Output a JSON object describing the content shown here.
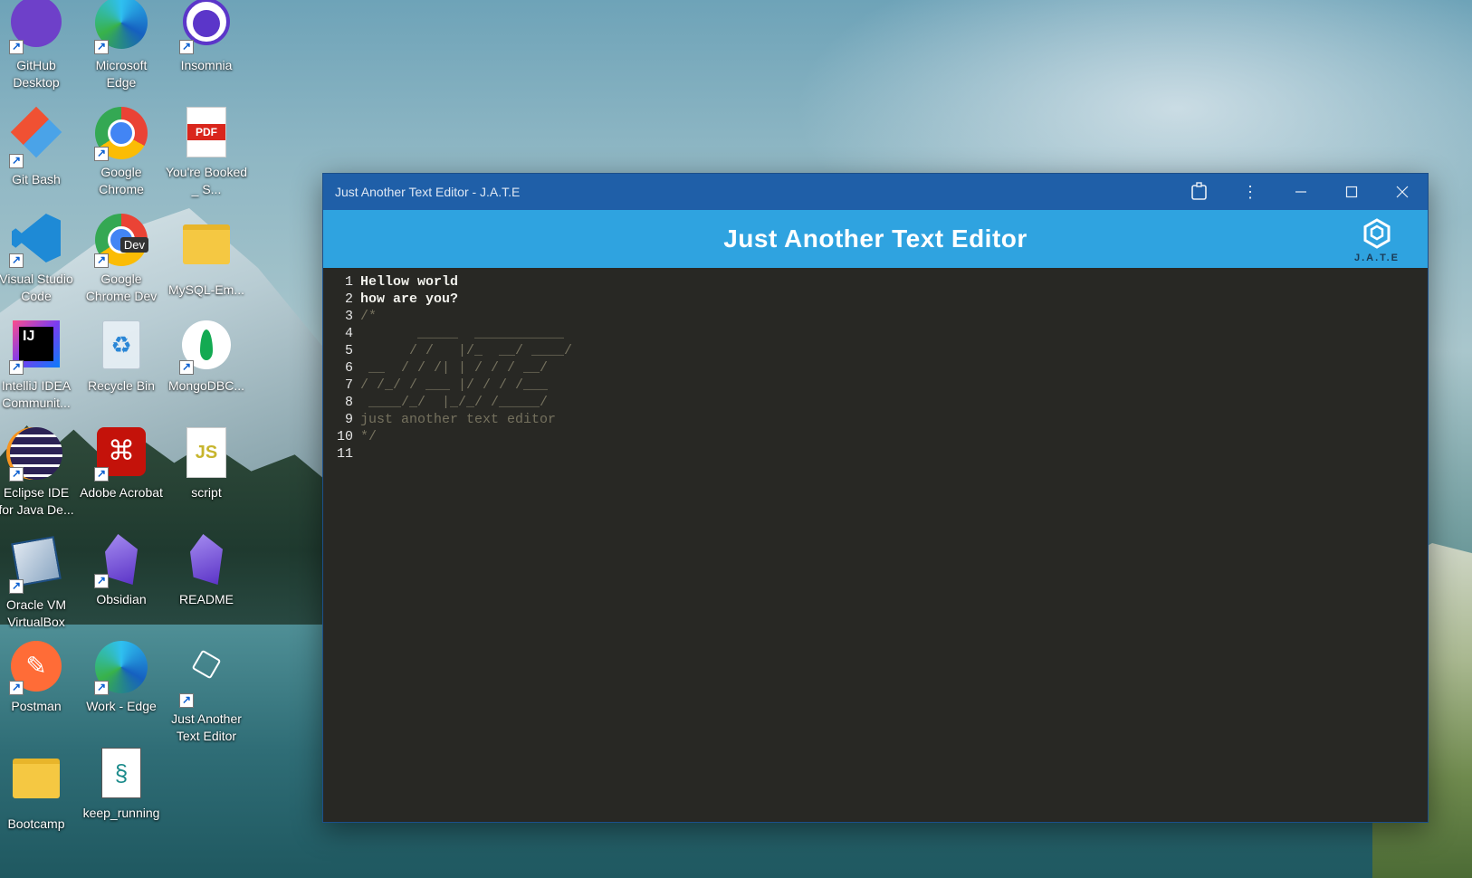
{
  "desktop": {
    "icons": [
      {
        "label": "GitHub Desktop",
        "icon": "github-desktop-icon"
      },
      {
        "label": "Microsoft Edge",
        "icon": "edge-icon"
      },
      {
        "label": "Insomnia",
        "icon": "insomnia-icon"
      },
      {
        "label": "Git Bash",
        "icon": "git-bash-icon"
      },
      {
        "label": "Google Chrome",
        "icon": "chrome-icon"
      },
      {
        "label": "You're Booked _ S...",
        "icon": "pdf-file-icon"
      },
      {
        "label": "Visual Studio Code",
        "icon": "vscode-icon"
      },
      {
        "label": "Google Chrome Dev",
        "icon": "chrome-dev-icon"
      },
      {
        "label": "MySQL-Em...",
        "icon": "folder-icon"
      },
      {
        "label": "IntelliJ IDEA Communit...",
        "icon": "intellij-icon"
      },
      {
        "label": "Recycle Bin",
        "icon": "recycle-bin-icon"
      },
      {
        "label": "MongoDBC...",
        "icon": "mongodb-compass-icon"
      },
      {
        "label": "Eclipse IDE for Java De...",
        "icon": "eclipse-icon"
      },
      {
        "label": "Adobe Acrobat",
        "icon": "acrobat-icon"
      },
      {
        "label": "script",
        "icon": "js-file-icon"
      },
      {
        "label": "Oracle VM VirtualBox",
        "icon": "virtualbox-icon"
      },
      {
        "label": "Obsidian",
        "icon": "obsidian-icon"
      },
      {
        "label": "README",
        "icon": "obsidian-file-icon"
      },
      {
        "label": "Postman",
        "icon": "postman-icon"
      },
      {
        "label": "Work - Edge",
        "icon": "edge-work-icon"
      },
      {
        "label": "Just Another Text Editor",
        "icon": "jate-icon"
      },
      {
        "label": "Bootcamp",
        "icon": "folder-icon"
      },
      {
        "label": "keep_running",
        "icon": "script-file-icon"
      }
    ],
    "badges": {
      "chrome_dev": "Dev",
      "pdf": "PDF",
      "intellij": "IJ",
      "js": "JS"
    }
  },
  "window": {
    "title": "Just Another Text Editor - J.A.T.E",
    "controls": {
      "extension": "extension-icon",
      "menu": "more-icon",
      "minimize": "minimize-icon",
      "maximize": "maximize-icon",
      "close": "close-icon"
    },
    "header_title": "Just Another Text Editor",
    "logo_text": "J.A.T.E",
    "editor_lines": [
      {
        "n": "1",
        "text": "Hellow world",
        "comment": false
      },
      {
        "n": "2",
        "text": "how are you?",
        "comment": false
      },
      {
        "n": "3",
        "text": "/*",
        "comment": true
      },
      {
        "n": "4",
        "text": "       _____  ___________",
        "comment": true
      },
      {
        "n": "5",
        "text": "      / /   |/_  __/ ____/",
        "comment": true
      },
      {
        "n": "6",
        "text": " __  / / /| | / / / __/",
        "comment": true
      },
      {
        "n": "7",
        "text": "/ /_/ / ___ |/ / / /___",
        "comment": true
      },
      {
        "n": "8",
        "text": " ____/_/  |_/_/ /_____/",
        "comment": true
      },
      {
        "n": "9",
        "text": "just another text editor",
        "comment": true
      },
      {
        "n": "10",
        "text": "*/",
        "comment": true
      },
      {
        "n": "11",
        "text": "",
        "comment": false
      }
    ]
  }
}
